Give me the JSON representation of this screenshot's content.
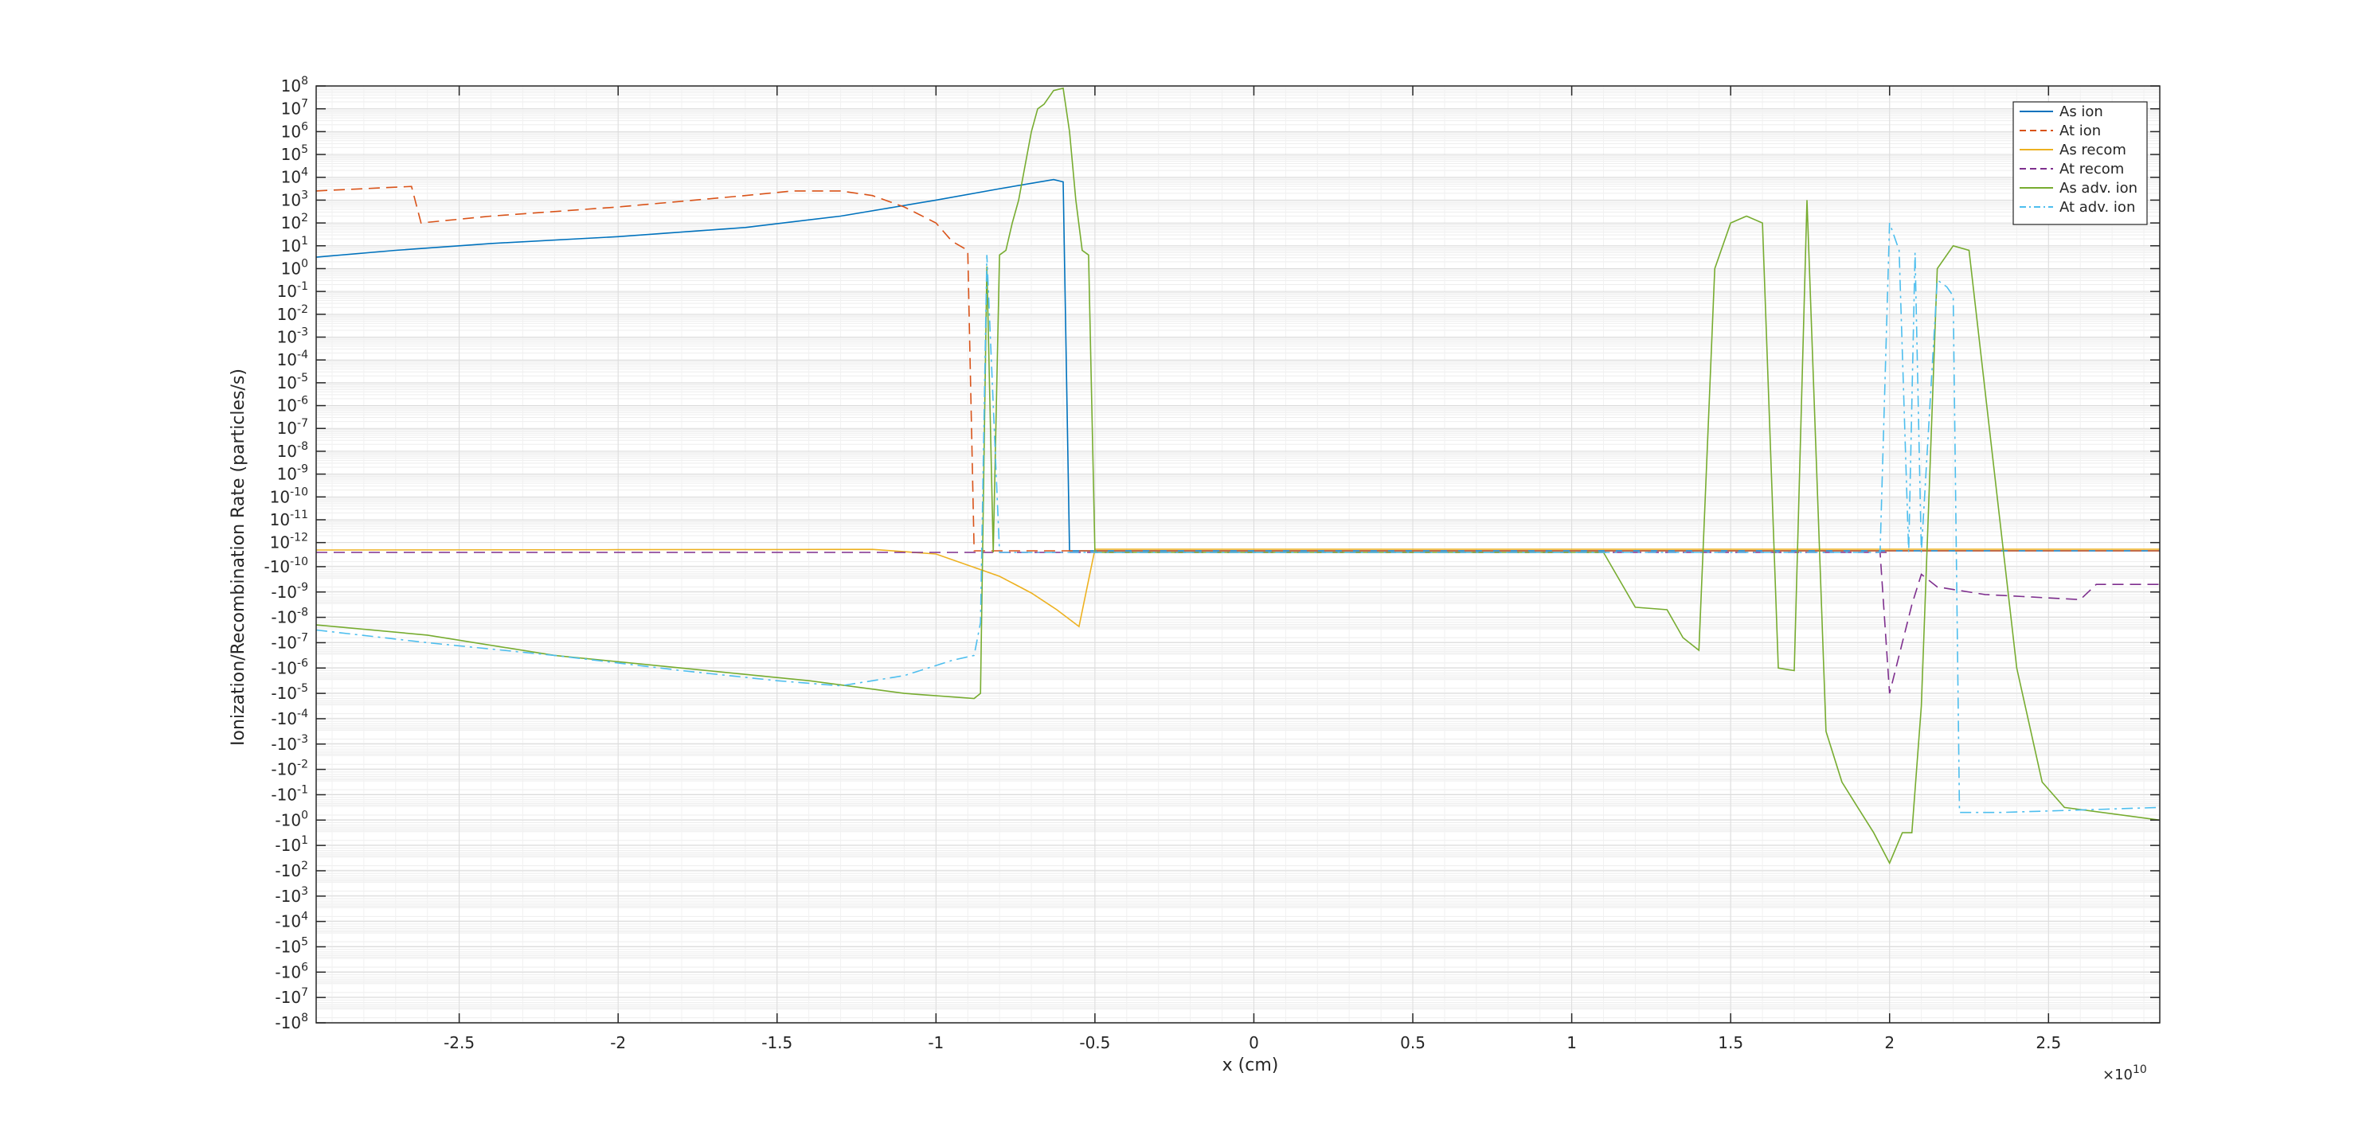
{
  "chart_data": {
    "type": "line",
    "title": "",
    "xlabel": "x (cm)",
    "ylabel": "Ionization/Recombination Rate (particles/s)",
    "x_multiplier_label": "×10",
    "x_multiplier_exp": "10",
    "xlim": [
      -2.95,
      2.85
    ],
    "x_ticks": [
      -2.5,
      -2,
      -1.5,
      -1,
      -0.5,
      0,
      0.5,
      1,
      1.5,
      2,
      2.5
    ],
    "x_tick_labels": [
      "-2.5",
      "-2",
      "-1.5",
      "-1",
      "-0.5",
      "0",
      "0.5",
      "1",
      "1.5",
      "2",
      "2.5"
    ],
    "y_scale": "symlog (signed log10, both directions)",
    "ylim_exponent": [
      -8,
      8
    ],
    "y_pos_tick_exponents": [
      8,
      7,
      6,
      5,
      4,
      3,
      2,
      1,
      0,
      -1,
      -2,
      -3,
      -4,
      -5,
      -6,
      -7,
      -8,
      -9,
      -10,
      -11,
      -12
    ],
    "y_neg_tick_exponents": [
      -10,
      -9,
      -8,
      -7,
      -6,
      -5,
      -4,
      -3,
      -2,
      -1,
      0,
      1,
      2,
      3,
      4,
      5,
      6,
      7,
      8
    ],
    "grid": "on (major and minor)",
    "legend_position": "top-right",
    "series": [
      {
        "name": "As ion",
        "color": "#0072bd",
        "dash": "solid",
        "points": [
          [
            -2.95,
            0.5
          ],
          [
            -2.7,
            0.8
          ],
          [
            -2.4,
            1.1
          ],
          [
            -2.0,
            1.4
          ],
          [
            -1.6,
            1.8
          ],
          [
            -1.3,
            2.3
          ],
          [
            -1.0,
            3.0
          ],
          [
            -0.8,
            3.5
          ],
          [
            -0.63,
            3.9
          ],
          [
            -0.6,
            3.8
          ],
          [
            -0.58,
            -12.0
          ],
          [
            -0.56,
            -12.0
          ],
          [
            2.85,
            -12.0
          ]
        ]
      },
      {
        "name": "At ion",
        "color": "#d95319",
        "dash": "dashed",
        "points": [
          [
            -2.95,
            3.4
          ],
          [
            -2.65,
            3.6
          ],
          [
            -2.62,
            2.0
          ],
          [
            -2.4,
            2.3
          ],
          [
            -2.0,
            2.7
          ],
          [
            -1.6,
            3.2
          ],
          [
            -1.45,
            3.4
          ],
          [
            -1.3,
            3.4
          ],
          [
            -1.2,
            3.2
          ],
          [
            -1.1,
            2.7
          ],
          [
            -1.0,
            2.0
          ],
          [
            -0.95,
            1.2
          ],
          [
            -0.9,
            0.8
          ],
          [
            -0.88,
            -12.5
          ],
          [
            2.85,
            -12.5
          ]
        ]
      },
      {
        "name": "As recom",
        "color": "#edb120",
        "dash": "solid",
        "points": [
          [
            -2.95,
            1.0
          ],
          [
            -2.0,
            0.8
          ],
          [
            -1.5,
            0.7
          ],
          [
            -1.2,
            0.6
          ],
          [
            -1.0,
            0.4
          ],
          [
            -0.8,
            0.0
          ],
          [
            -0.7,
            -0.3
          ],
          [
            -0.62,
            -0.6
          ],
          [
            -0.55,
            -0.9
          ],
          [
            -0.5,
            0.5
          ],
          [
            2.85,
            0.5
          ]
        ]
      },
      {
        "name": "At recom",
        "color": "#7e2f8e",
        "dash": "dashed",
        "points": [
          [
            -2.95,
            0.5
          ],
          [
            2.0,
            0.5
          ],
          [
            1.97,
            0.6
          ],
          [
            2.0,
            -9.5
          ],
          [
            2.03,
            -8.0
          ],
          [
            2.07,
            -6.0
          ],
          [
            2.1,
            -4.8
          ],
          [
            2.15,
            -5.3
          ],
          [
            2.3,
            -5.6
          ],
          [
            2.45,
            -5.7
          ],
          [
            2.6,
            -5.8
          ],
          [
            2.65,
            -5.2
          ],
          [
            2.85,
            -5.2
          ],
          [
            2.85,
            -5.2
          ]
        ]
      },
      {
        "name": "As adv. ion",
        "color": "#77ac30",
        "dash": "solid",
        "points": [
          [
            -2.95,
            0.2
          ],
          [
            -2.6,
            -0.2
          ],
          [
            -2.2,
            -1.0
          ],
          [
            -1.8,
            -1.5
          ],
          [
            -1.4,
            -2.0
          ],
          [
            -1.1,
            -2.5
          ],
          [
            -0.88,
            -2.7
          ],
          [
            -0.86,
            -2.5
          ],
          [
            -0.84,
            0.1
          ],
          [
            -0.82,
            0.5
          ],
          [
            -0.8,
            0.6
          ],
          [
            -0.78,
            0.8
          ],
          [
            -0.76,
            2.0
          ],
          [
            -0.74,
            3.0
          ],
          [
            -0.72,
            4.5
          ],
          [
            -0.7,
            6.0
          ],
          [
            -0.68,
            7.0
          ],
          [
            -0.66,
            7.2
          ],
          [
            -0.63,
            7.8
          ],
          [
            -0.6,
            7.9
          ],
          [
            -0.58,
            6.0
          ],
          [
            -0.56,
            3.0
          ],
          [
            -0.54,
            0.8
          ],
          [
            -0.52,
            0.6
          ],
          [
            -0.5,
            0.5
          ],
          [
            1.0,
            0.5
          ],
          [
            1.1,
            0.5
          ],
          [
            1.2,
            0.9
          ],
          [
            1.3,
            0.8
          ],
          [
            1.35,
            -0.3
          ],
          [
            1.4,
            -0.8
          ],
          [
            1.45,
            0.0
          ],
          [
            1.5,
            2.0
          ],
          [
            1.55,
            2.3
          ],
          [
            1.6,
            2.0
          ],
          [
            1.65,
            -1.5
          ],
          [
            1.7,
            -1.6
          ],
          [
            1.74,
            3.0
          ],
          [
            1.8,
            -4.0
          ],
          [
            1.85,
            -6.0
          ],
          [
            1.9,
            -7.0
          ],
          [
            1.95,
            -8.0
          ],
          [
            2.0,
            -9.2
          ],
          [
            2.04,
            -8.0
          ],
          [
            2.07,
            -8.0
          ],
          [
            2.1,
            -3.0
          ],
          [
            2.15,
            0.0
          ],
          [
            2.2,
            1.0
          ],
          [
            2.25,
            0.8
          ],
          [
            2.4,
            -1.5
          ],
          [
            2.48,
            -6.0
          ],
          [
            2.55,
            -7.0
          ],
          [
            2.85,
            -7.5
          ]
        ]
      },
      {
        "name": "At adv. ion",
        "color": "#4dbeee",
        "dash": "dash-dot",
        "points": [
          [
            -2.95,
            0.0
          ],
          [
            -2.6,
            -0.5
          ],
          [
            -2.2,
            -1.0
          ],
          [
            -1.8,
            -1.6
          ],
          [
            -1.5,
            -2.0
          ],
          [
            -1.3,
            -2.2
          ],
          [
            -1.1,
            -1.8
          ],
          [
            -0.95,
            -1.2
          ],
          [
            -0.88,
            -1.0
          ],
          [
            -0.86,
            0.3
          ],
          [
            -0.84,
            0.6
          ],
          [
            -0.8,
            0.5
          ],
          [
            1.97,
            0.5
          ],
          [
            2.0,
            2.0
          ],
          [
            2.03,
            0.8
          ],
          [
            2.06,
            0.5
          ],
          [
            2.08,
            0.7
          ],
          [
            2.1,
            0.5
          ],
          [
            2.15,
            -0.5
          ],
          [
            2.18,
            -0.8
          ],
          [
            2.2,
            -1.2
          ],
          [
            2.22,
            -7.2
          ],
          [
            2.35,
            -7.2
          ],
          [
            2.6,
            -7.1
          ],
          [
            2.85,
            -7.0
          ]
        ]
      }
    ],
    "segments_note": ""
  }
}
